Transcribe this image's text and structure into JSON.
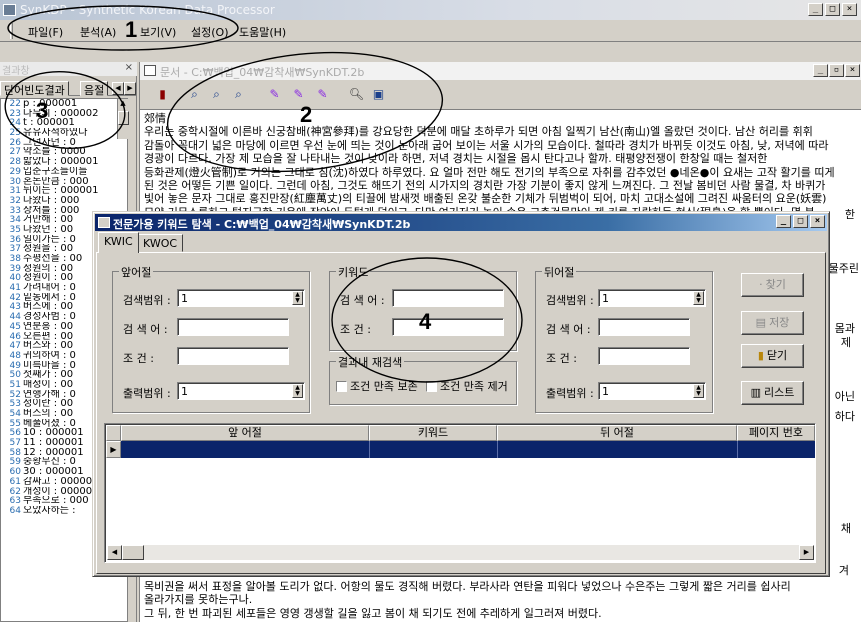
{
  "app": {
    "title": "SynKDP - Synthetic Korean Data Processor"
  },
  "menu": [
    {
      "label": "파일(F)"
    },
    {
      "label": "분석(A)"
    },
    {
      "label": "보기(V)"
    },
    {
      "label": "설정(O)"
    },
    {
      "label": "도움말(H)"
    }
  ],
  "left_panel": {
    "title": "결과창",
    "close_glyph": "×",
    "tabs": [
      "단어빈도결과",
      "음절"
    ],
    "rows": [
      {
        "n": "22",
        "t": "p : 000001"
      },
      {
        "n": "23",
        "t": "나무의 : 000002"
      },
      {
        "n": "24",
        "t": "t : 000001"
      },
      {
        "n": "25",
        "t": "유유자적하였다"
      },
      {
        "n": "26",
        "t": "그던자던 : 0"
      },
      {
        "n": "27",
        "t": "약소를 : 0000"
      },
      {
        "n": "28",
        "t": "밟았다 : 000001"
      },
      {
        "n": "29",
        "t": "입춘구조들이들"
      },
      {
        "n": "30",
        "t": "혼돈만큼 : 000"
      },
      {
        "n": "31",
        "t": "뒤이는 : 000001"
      },
      {
        "n": "32",
        "t": "나왔다 : 000"
      },
      {
        "n": "33",
        "t": "상처를 : 000"
      },
      {
        "n": "34",
        "t": "거만해 : 00"
      },
      {
        "n": "35",
        "t": "나왔던 : 00"
      },
      {
        "n": "36",
        "t": "일이가는 : 0"
      },
      {
        "n": "37",
        "t": "정원을 : 00"
      },
      {
        "n": "38",
        "t": "수평선을 : 00"
      },
      {
        "n": "39",
        "t": "정원의 : 00"
      },
      {
        "n": "40",
        "t": "정원이 : 00"
      },
      {
        "n": "41",
        "t": "가려내어 : 0"
      },
      {
        "n": "42",
        "t": "밑동에서 : 0"
      },
      {
        "n": "43",
        "t": "버스에 : 00"
      },
      {
        "n": "44",
        "t": "경성사범 : 0"
      },
      {
        "n": "45",
        "t": "연분홍 : 00"
      },
      {
        "n": "46",
        "t": "오른편 : 00"
      },
      {
        "n": "47",
        "t": "버스와 : 00"
      },
      {
        "n": "48",
        "t": "귀의하여 : 0"
      },
      {
        "n": "49",
        "t": "미륵마을 : 0"
      },
      {
        "n": "50",
        "t": "첫째가 : 00"
      },
      {
        "n": "51",
        "t": "매정이 : 00"
      },
      {
        "n": "52",
        "t": "연행가해 : 0"
      },
      {
        "n": "53",
        "t": "정이란 : 00"
      },
      {
        "n": "54",
        "t": "버스의 : 00"
      },
      {
        "n": "55",
        "t": "베풀어졌 : 0"
      },
      {
        "n": "56",
        "t": "10 : 000001"
      },
      {
        "n": "57",
        "t": "11 : 000001"
      },
      {
        "n": "58",
        "t": "12 : 000001"
      },
      {
        "n": "59",
        "t": "중황무진 : 0"
      },
      {
        "n": "60",
        "t": "30 : 000001"
      },
      {
        "n": "61",
        "t": "감싸고 : 000001"
      },
      {
        "n": "62",
        "t": "개성이 : 000001"
      },
      {
        "n": "63",
        "t": "부족으로 : 000"
      },
      {
        "n": "64",
        "t": "오았자하는 :"
      }
    ]
  },
  "doc": {
    "title": "문서 - C:₩백업_04₩감착새₩SynKDT.2b",
    "toolbar_icons": [
      "book-icon",
      "find-icon",
      "find-next-icon",
      "find-prev-icon",
      "mark-icon",
      "mark-next-icon",
      "mark-prev-icon",
      "zoom-icon",
      "export-icon"
    ],
    "lines": [
      "郊情",
      "우리는 중학시절에 이른바 신궁참배(神宮參拜)를 강요당한 덕분에 매달 초하루가 되면 아침 일찍기 남산(南山)엘 올랐던 것이다. 남산 허리를 휘휘",
      "감돌아 꼭대기 넓은 마당에 이르면 우선 눈에 띄는 것이 눈아래 굽어 보이는 서울 시가의 모습이다. 철따라 경치가 바뀌듯 이것도 아침, 낮, 저녁에 따라",
      "경광이 다르다. 가장 제 모습을 잘 나타내는 것이 낮이라 하면, 저녁 경치는 시절을 몹시 탄다고나 할까. 태평양전쟁이 한창일 때는 철저한",
      "등화관제(燈火管制)로 거의는 그대로 침(沈)하였다 하루였다. 요 얼마 전만 해도 전기의 부족으로 자취를 감추었던 ●네온●이 요새는 고작 활기를 띠게",
      "된 것은 어떻든 기쁜 일이다. 그런데 아침, 그것도 해뜨기 전의 시가지의 경치란 가장 기분이 좋지 않게 느껴진다. 그 전날 봄비던 사람 물결, 차 바퀴가",
      "빛어 놓은 문자 그대로 홍진만장(紅塵萬丈)의 티끌에 밤새껏 배출된 온갖 불순한 기체가 뒤범벅이 되어, 마치 고대소설에 그려진 싸움터의 요운(妖雲)",
      "모양 거무스름하고 텁지근한 기운에 장안이 두텁게 덮이고, 다만 여기저기 높이 솟은 고층건물만이 제 키를 자랑하듯 현신(現身)을 할 뿐이다. 몇 분"
    ],
    "side_fragments": [
      "한",
      "물주린",
      "몸과",
      "제",
      "아닌",
      "하다",
      "채",
      "겨"
    ],
    "bottom_lines": [
      "목비권을 써서 표정을 알아볼 도리가 없다. 어항의 물도 경직해 버렸다. 부라사라 연탄을 피워다 넣었으나 수은주는 그렇게 짧은 거리를 쉽사리",
      "올라가지를 못하는구나.",
      "그 뒤, 한 번 파괴된 세포들은 영영 갱생할 길을 잃고 봄이 채 되기도 전에 추레하게 일그러져 버렸다."
    ]
  },
  "dialog": {
    "title": "전문가용 키워드 탐색 - C:₩백업_04₩감착새₩SynKDT.2b",
    "tabs": [
      "KWIC",
      "KWOC"
    ],
    "left_group": {
      "label": "앞어절",
      "range_label": "검색범위 :",
      "range_value": "1",
      "word_label": "검 색 어 :",
      "word_value": "",
      "cond_label": "조    건 :",
      "cond_value": "",
      "out_label": "출력범위 :",
      "out_value": "1"
    },
    "keyword_group": {
      "label": "키워드",
      "word_label": "검 색 어 :",
      "word_value": "",
      "cond_label": "조    건 :",
      "cond_value": ""
    },
    "result_group": {
      "label": "결과내 재검색",
      "opt1": "조건 만족 보존",
      "opt2": "조건 만족 제거"
    },
    "right_group": {
      "label": "뒤어절",
      "range_label": "검색범위 :",
      "range_value": "1",
      "word_label": "검 색 어 :",
      "word_value": "",
      "cond_label": "조    건 :",
      "cond_value": "",
      "out_label": "출력범위 :",
      "out_value": "1"
    },
    "buttons": {
      "find": "찾기",
      "save": "저장",
      "close": "닫기",
      "list": "리스트"
    },
    "grid_headers": [
      "앞 어절",
      "키워드",
      "뒤 어절",
      "페이지 번호"
    ]
  },
  "annotations": [
    "1",
    "2",
    "3",
    "4"
  ]
}
